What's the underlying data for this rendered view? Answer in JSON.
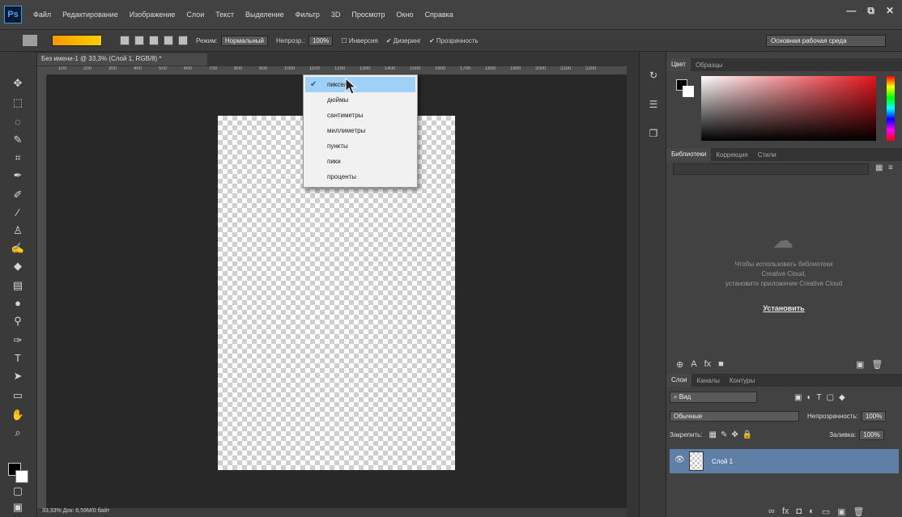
{
  "app": {
    "logo": "Ps",
    "menu": [
      "Файл",
      "Редактирование",
      "Изображение",
      "Слои",
      "Текст",
      "Выделение",
      "Фильтр",
      "3D",
      "Просмотр",
      "Окно",
      "Справка"
    ],
    "window_controls": [
      "—",
      "⧉",
      "✕"
    ]
  },
  "options_bar": {
    "mode_label": "Режим:",
    "mode_value": "Нормальный",
    "opacity_label": "Непрозр.:",
    "opacity_value": "100%",
    "checks": [
      "Инверсия",
      "Дизеринг",
      "Прозрачность"
    ],
    "workspace": "Основная рабочая среда"
  },
  "document": {
    "tab_title": "Без имени-1 @ 33,3% (Слой 1, RGB/8) *",
    "ruler_ticks": [
      "100",
      "200",
      "300",
      "400",
      "500",
      "600",
      "700",
      "800",
      "900",
      "1000",
      "1100",
      "1200",
      "1300",
      "1400",
      "1500",
      "1600",
      "1700",
      "1800",
      "1900",
      "2000",
      "2100",
      "2200"
    ],
    "status": "33,33%    Док: 6,59M/0 байт"
  },
  "unit_menu": {
    "items": [
      {
        "label": "пиксели",
        "checked": true
      },
      {
        "label": "дюймы",
        "checked": false
      },
      {
        "label": "сантиметры",
        "checked": false
      },
      {
        "label": "миллиметры",
        "checked": false
      },
      {
        "label": "пункты",
        "checked": false
      },
      {
        "label": "пики",
        "checked": false
      },
      {
        "label": "проценты",
        "checked": false
      }
    ]
  },
  "color_panel": {
    "tabs": [
      "Цвет",
      "Образцы"
    ]
  },
  "libraries_panel": {
    "tabs": [
      "Библиотеки",
      "Коррекция",
      "Стили"
    ],
    "message_lines": [
      "Чтобы использовать библиотеки",
      "Creative Cloud,",
      "установите приложение Creative Cloud"
    ],
    "install_link": "Установить"
  },
  "layers_panel": {
    "tabs": [
      "Слои",
      "Каналы",
      "Контуры"
    ],
    "filter_label": "Вид",
    "blend_mode": "Обычные",
    "opacity_label": "Непрозрачность:",
    "opacity_value": "100%",
    "lock_label": "Закрепить:",
    "fill_label": "Заливка:",
    "fill_value": "100%",
    "layer_name": "Слой 1"
  },
  "colors": {
    "accent": "#5f7fa6",
    "menu_highlight": "#9fd0f6",
    "gradient_start": "#f59a00",
    "gradient_end": "#ffd000"
  }
}
